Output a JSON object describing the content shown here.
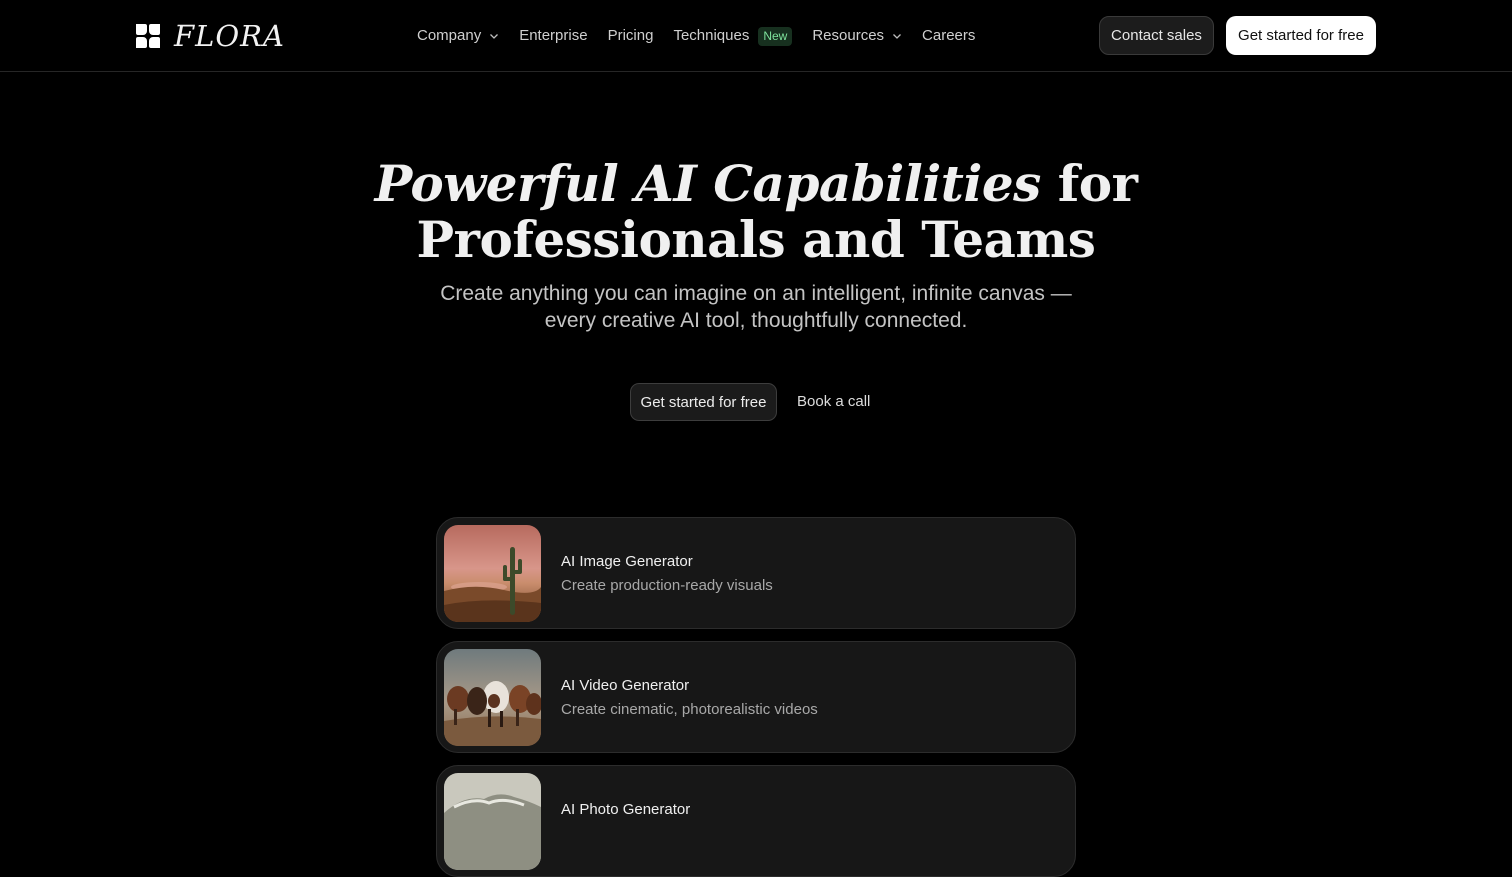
{
  "brand": {
    "logo_icon": "flora-four-petal-icon",
    "name": "FLORA"
  },
  "nav": {
    "items": [
      {
        "label": "Company",
        "dropdown": true
      },
      {
        "label": "Enterprise",
        "dropdown": false
      },
      {
        "label": "Pricing",
        "dropdown": false
      },
      {
        "label": "Techniques",
        "dropdown": false,
        "badge": "New"
      },
      {
        "label": "Resources",
        "dropdown": true
      },
      {
        "label": "Careers",
        "dropdown": false
      }
    ],
    "contact_label": "Contact sales",
    "start_label": "Get started for free"
  },
  "hero": {
    "title_italic": "Powerful AI Capabilities",
    "title_rest_line1": " for",
    "title_line2": "Professionals and Teams",
    "subtitle_line1": "Create anything you can imagine on an intelligent, infinite canvas —",
    "subtitle_line2": "every creative AI tool, thoughtfully connected.",
    "cta_primary": "Get started for free",
    "cta_secondary": "Book a call"
  },
  "cards": [
    {
      "title": "AI Image Generator",
      "desc": "Create production-ready visuals",
      "thumb": "desert-cactus-image"
    },
    {
      "title": "AI Video Generator",
      "desc": "Create cinematic, photorealistic videos",
      "thumb": "running-horses-image"
    },
    {
      "title": "AI Photo Generator",
      "desc": "",
      "thumb": "mountain-image"
    }
  ],
  "colors": {
    "background": "#000000",
    "badge_bg": "#17301f",
    "badge_text": "#7ee29c",
    "card_bg": "#171717"
  }
}
